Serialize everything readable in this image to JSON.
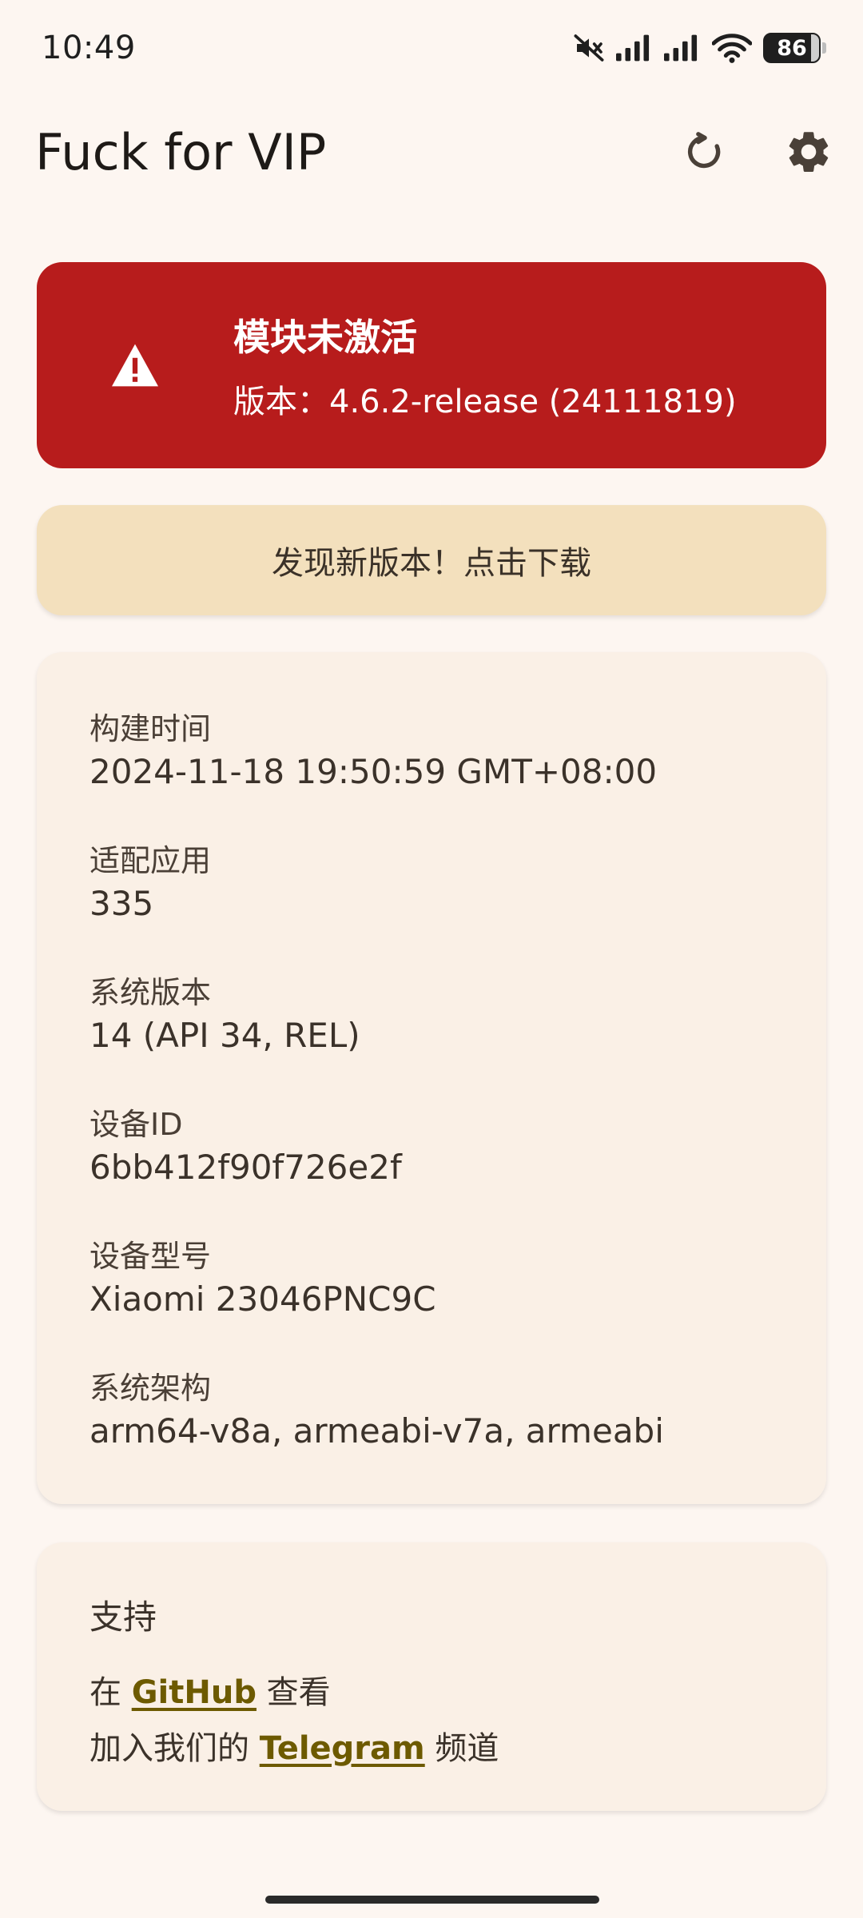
{
  "status_bar": {
    "time": "10:49",
    "battery": "86",
    "icons": [
      "mute-icon",
      "signal-icon",
      "signal-icon",
      "wifi-icon",
      "battery-icon"
    ]
  },
  "app_bar": {
    "title": "Fuck for VIP",
    "actions": [
      "refresh-icon",
      "settings-icon"
    ]
  },
  "module_status": {
    "title": "模块未激活",
    "version": "版本：4.6.2-release (24111819)",
    "icon": "warning-icon",
    "color": "#b71c1c"
  },
  "update_banner": {
    "label": "发现新版本！点击下载",
    "color": "#f3e0bd"
  },
  "info": {
    "build_time": {
      "label": "构建时间",
      "value": "2024-11-18 19:50:59 GMT+08:00"
    },
    "supported_apps": {
      "label": "适配应用",
      "value": "335"
    },
    "system_version": {
      "label": "系统版本",
      "value": "14 (API 34, REL)"
    },
    "device_id": {
      "label": "设备ID",
      "value": "6bb412f90f726e2f"
    },
    "device_model": {
      "label": "设备型号",
      "value": "Xiaomi 23046PNC9C"
    },
    "system_arch": {
      "label": "系统架构",
      "value": "arm64-v8a, armeabi-v7a, armeabi"
    }
  },
  "support": {
    "title": "支持",
    "github": {
      "prefix": "在 ",
      "link": "GitHub",
      "suffix": " 查看"
    },
    "telegram": {
      "prefix": "加入我们的 ",
      "link": "Telegram",
      "suffix": " 频道"
    },
    "link_color": "#6d5a00"
  }
}
